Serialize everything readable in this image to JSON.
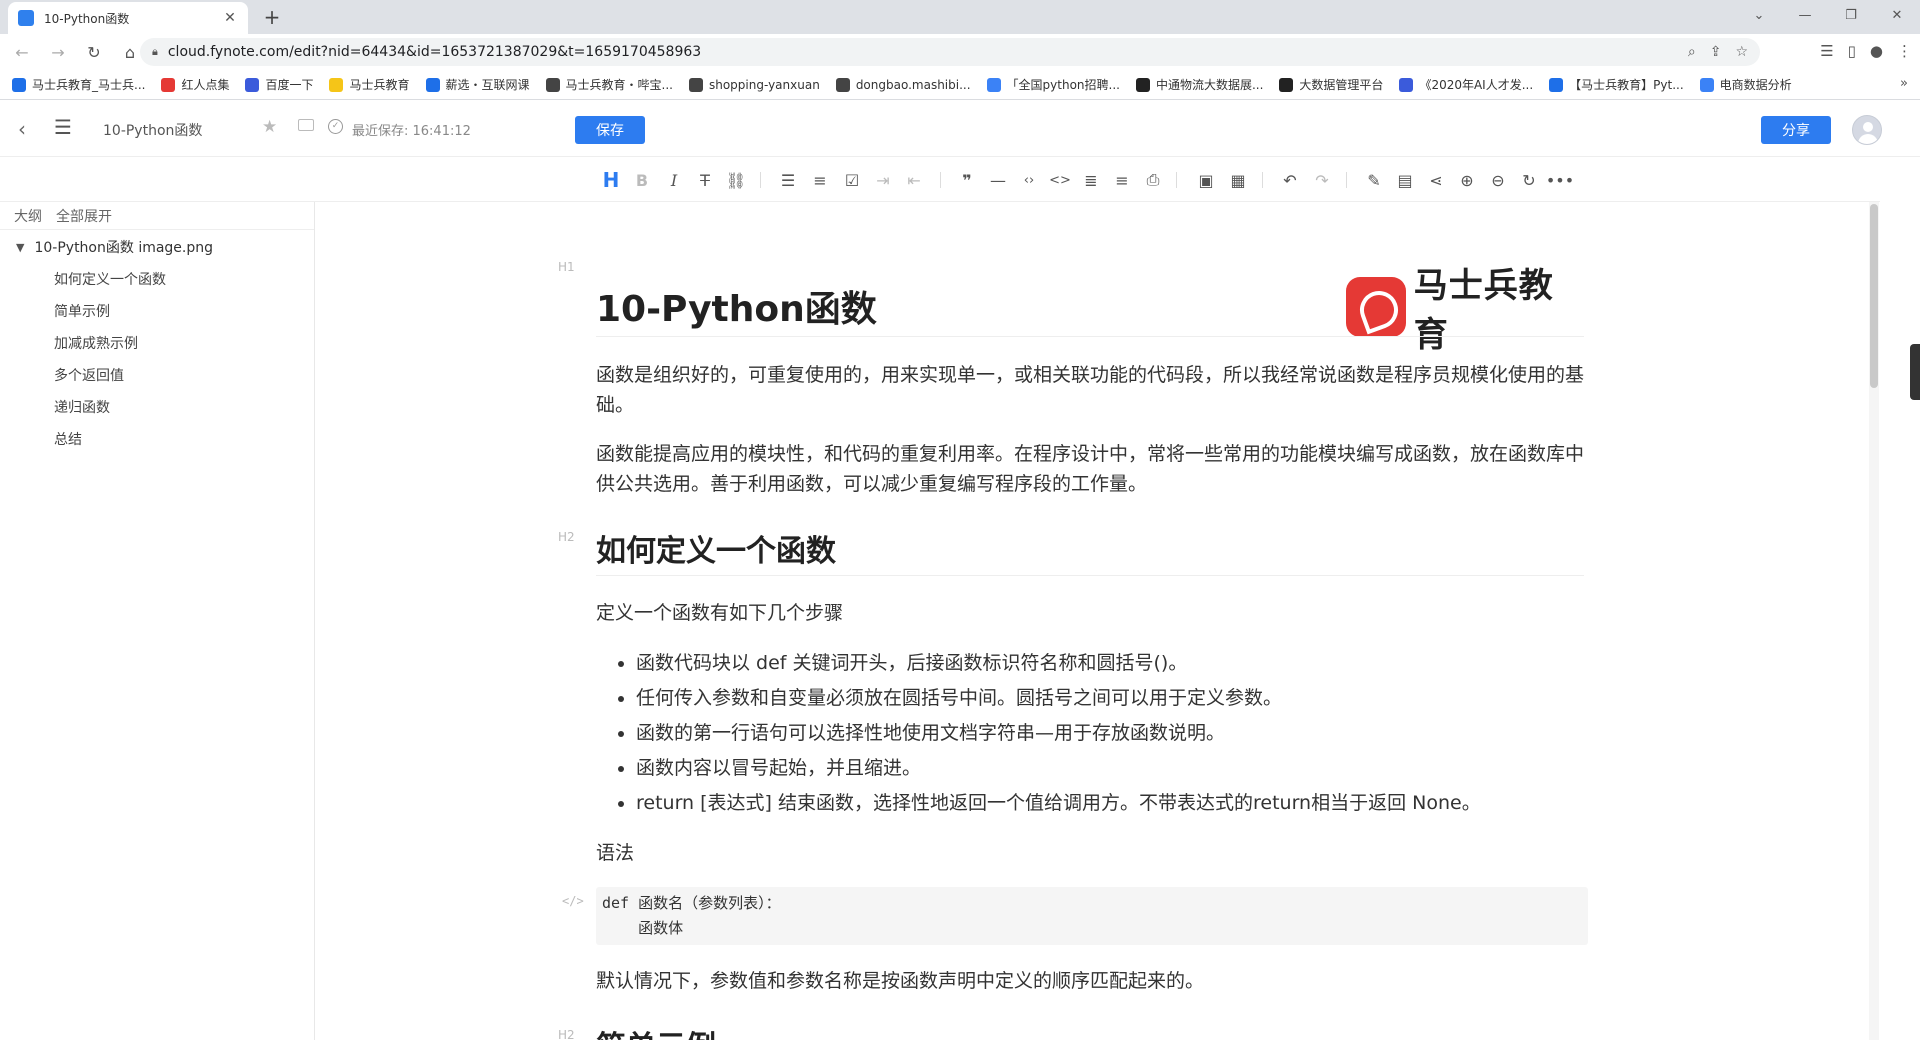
{
  "browser": {
    "tab_title": "10-Python函数",
    "url": "cloud.fynote.com/edit?nid=64434&id=1653721387029&t=1659170458963",
    "bookmarks": [
      {
        "label": "马士兵教育_马士兵...",
        "color": "#1e6fe8"
      },
      {
        "label": "红人点集",
        "color": "#e53935"
      },
      {
        "label": "百度一下",
        "color": "#3b5bdb"
      },
      {
        "label": "马士兵教育",
        "color": "#f5c518"
      },
      {
        "label": "薪选・互联网课",
        "color": "#1e6fe8"
      },
      {
        "label": "马士兵教育・哔宝...",
        "color": "#444444"
      },
      {
        "label": "shopping-yanxuan",
        "color": "#444444"
      },
      {
        "label": "dongbao.mashibi...",
        "color": "#444444"
      },
      {
        "label": "「全国python招聘...",
        "color": "#3b82f6"
      },
      {
        "label": "中通物流大数据展...",
        "color": "#222222"
      },
      {
        "label": "大数据管理平台",
        "color": "#222222"
      },
      {
        "label": "《2020年AI人才发...",
        "color": "#3b5bdb"
      },
      {
        "label": "【马士兵教育】Pyt...",
        "color": "#1e6fe8"
      },
      {
        "label": "电商数据分析",
        "color": "#3b82f6"
      }
    ]
  },
  "header": {
    "doc_title": "10-Python函数",
    "saved_time": "最近保存: 16:41:12",
    "save_label": "保存",
    "share_label": "分享"
  },
  "sidebar": {
    "outline_label": "大纲",
    "expand_all_label": "全部展开",
    "root": "10-Python函数 image.png",
    "items": [
      {
        "label": "如何定义一个函数"
      },
      {
        "label": "简单示例"
      },
      {
        "label": "加减成熟示例"
      },
      {
        "label": "多个返回值"
      },
      {
        "label": "递归函数"
      },
      {
        "label": "总结"
      }
    ]
  },
  "doc": {
    "h1_level": "H1",
    "title": "10-Python函数",
    "logo_text": "马士兵教育",
    "intro1": "函数是组织好的，可重复使用的，用来实现单一，或相关联功能的代码段，所以我经常说函数是程序员规模化使用的基础。",
    "intro2": "函数能提高应用的模块性，和代码的重复利用率。在程序设计中，常将一些常用的功能模块编写成函数，放在函数库中供公共选用。善于利用函数，可以减少重复编写程序段的工作量。",
    "h2_level": "H2",
    "section1_title": "如何定义一个函数",
    "section1_lead": "定义一个函数有如下几个步骤",
    "bullets": [
      {
        "text": "函数代码块以 def 关键词开头，后接函数标识符名称和圆括号()。"
      },
      {
        "text": "任何传入参数和自变量必须放在圆括号中间。圆括号之间可以用于定义参数。"
      },
      {
        "text": "函数的第一行语句可以选择性地使用文档字符串—用于存放函数说明。"
      },
      {
        "text": "函数内容以冒号起始，并且缩进。"
      },
      {
        "text": "return [表达式] 结束函数，选择性地返回一个值给调用方。不带表达式的return相当于返回 None。"
      }
    ],
    "syntax_label": "语法",
    "code_tag": "</>",
    "code": "def 函数名（参数列表）：\n    函数体",
    "default_text": "默认情况下，参数值和参数名称是按函数声明中定义的顺序匹配起来的。",
    "next_level": "H2",
    "next_section_title": "简单示例"
  }
}
